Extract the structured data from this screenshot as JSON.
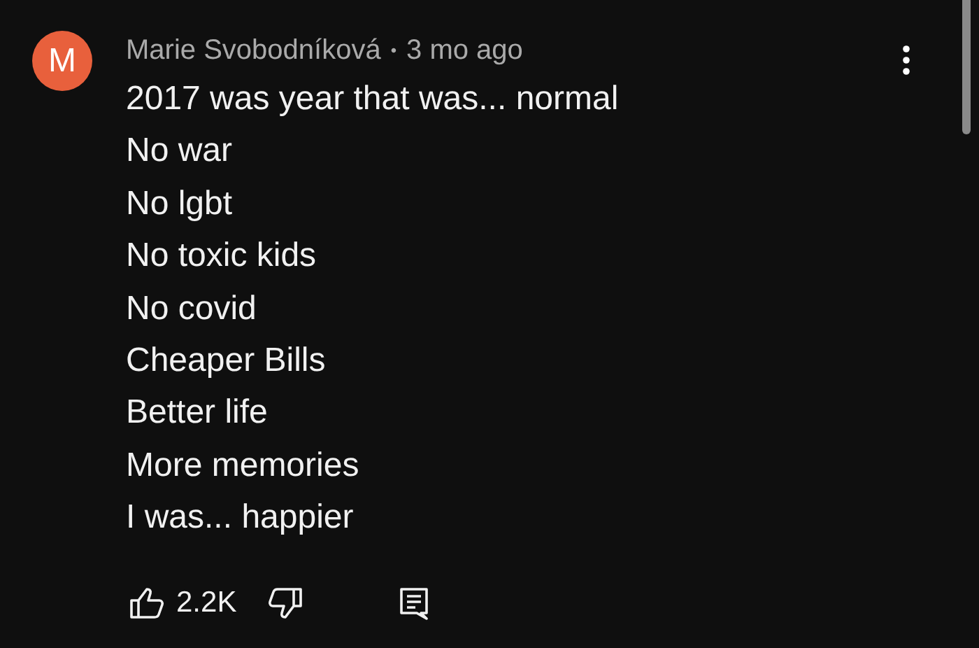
{
  "comment": {
    "avatar_letter": "M",
    "author": "Marie Svobodníková",
    "separator": "•",
    "time": "3 mo ago",
    "lines": [
      "2017 was year that was... normal",
      "No war",
      "No lgbt",
      "No toxic kids",
      "No covid",
      "Cheaper Bills",
      "Better life",
      "More memories",
      "I was... happier"
    ],
    "likes": "2.2K"
  }
}
